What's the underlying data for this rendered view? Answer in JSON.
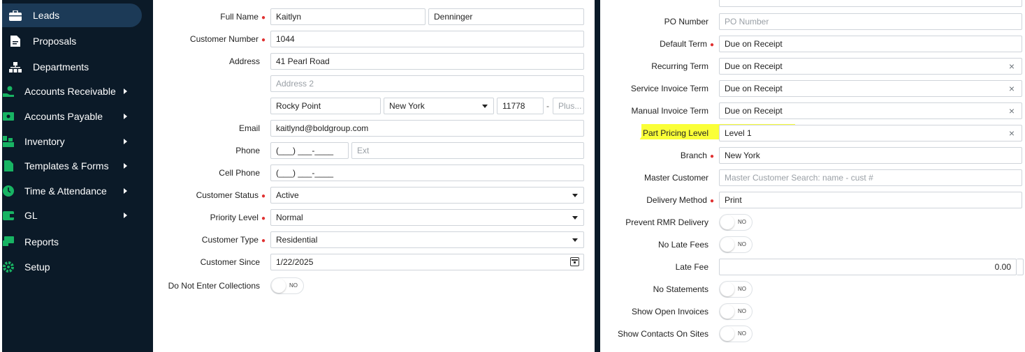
{
  "sidebar": {
    "items": [
      {
        "label": "Leads",
        "icon": "briefcase-icon",
        "active": true,
        "submenu": false
      },
      {
        "label": "Proposals",
        "icon": "document-icon",
        "active": false,
        "submenu": false
      },
      {
        "label": "Departments",
        "icon": "org-chart-icon",
        "active": false,
        "submenu": false
      },
      {
        "label": "Accounts Receivable",
        "icon": "hand-money-icon",
        "active": false,
        "submenu": true
      },
      {
        "label": "Accounts Payable",
        "icon": "money-bill-icon",
        "active": false,
        "submenu": true
      },
      {
        "label": "Inventory",
        "icon": "boxes-icon",
        "active": false,
        "submenu": true
      },
      {
        "label": "Templates & Forms",
        "icon": "file-icon",
        "active": false,
        "submenu": true
      },
      {
        "label": "Time & Attendance",
        "icon": "clock-icon",
        "active": false,
        "submenu": true
      },
      {
        "label": "GL",
        "icon": "wallet-icon",
        "active": false,
        "submenu": true
      },
      {
        "label": "Reports",
        "icon": "chat-report-icon",
        "active": false,
        "submenu": false
      },
      {
        "label": "Setup",
        "icon": "gear-icon",
        "active": false,
        "submenu": false
      }
    ]
  },
  "left_form": {
    "full_name": {
      "label": "Full Name",
      "first": "Kaitlyn",
      "last": "Denninger"
    },
    "customer_number": {
      "label": "Customer Number",
      "value": "1044"
    },
    "address": {
      "label": "Address",
      "line1": "41 Pearl Road",
      "line2_placeholder": "Address 2",
      "city": "Rocky Point",
      "state": "New York",
      "zip": "11778",
      "plus_placeholder": "Plus..."
    },
    "email": {
      "label": "Email",
      "value": "kaitlynd@boldgroup.com"
    },
    "phone": {
      "label": "Phone",
      "value": "(___) ___-____",
      "ext_placeholder": "Ext"
    },
    "cell_phone": {
      "label": "Cell Phone",
      "value": "(___) ___-____"
    },
    "customer_status": {
      "label": "Customer Status",
      "value": "Active"
    },
    "priority_level": {
      "label": "Priority Level",
      "value": "Normal"
    },
    "customer_type": {
      "label": "Customer Type",
      "value": "Residential"
    },
    "customer_since": {
      "label": "Customer Since",
      "value": "1/22/2025"
    },
    "do_not_enter_collections": {
      "label": "Do Not Enter Collections",
      "value": "NO"
    }
  },
  "right_form": {
    "po_number": {
      "label": "PO Number",
      "placeholder": "PO Number"
    },
    "default_term": {
      "label": "Default Term",
      "value": "Due on Receipt"
    },
    "recurring_term": {
      "label": "Recurring Term",
      "value": "Due on Receipt"
    },
    "service_invoice_term": {
      "label": "Service Invoice Term",
      "value": "Due on Receipt"
    },
    "manual_invoice_term": {
      "label": "Manual Invoice Term",
      "value": "Due on Receipt"
    },
    "part_pricing_level": {
      "label": "Part Pricing Level",
      "value": "Level 1"
    },
    "branch": {
      "label": "Branch",
      "value": "New York"
    },
    "master_customer": {
      "label": "Master Customer",
      "placeholder": "Master Customer Search: name - cust #"
    },
    "delivery_method": {
      "label": "Delivery Method",
      "value": "Print"
    },
    "prevent_rmr_delivery": {
      "label": "Prevent RMR Delivery",
      "value": "NO"
    },
    "no_late_fees": {
      "label": "No Late Fees",
      "value": "NO"
    },
    "late_fee": {
      "label": "Late Fee",
      "value": "0.00"
    },
    "no_statements": {
      "label": "No Statements",
      "value": "NO"
    },
    "show_open_invoices": {
      "label": "Show Open Invoices",
      "value": "NO"
    },
    "show_contacts_on_sites": {
      "label": "Show Contacts On Sites",
      "value": "NO"
    }
  },
  "clear_symbol": "×",
  "colors": {
    "sidebar_bg": "#0b1a28",
    "sidebar_active": "#1c3a57",
    "icon_green": "#18b463",
    "required": "#e03131",
    "highlight": "#faff38"
  }
}
